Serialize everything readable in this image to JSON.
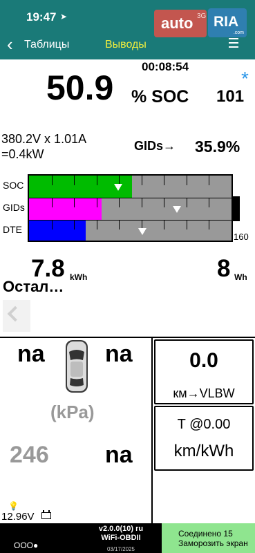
{
  "status_bar": {
    "time": "19:47",
    "arrow": "➤"
  },
  "watermark": {
    "left": "auto",
    "network": "3G",
    "right": "RIA",
    "domain": ".com"
  },
  "nav": {
    "back_label": "Таблицы",
    "outputs_label": "Выводы"
  },
  "main": {
    "timer": "00:08:54",
    "soc_value": "50.9",
    "soc_unit": "% SOC",
    "soc_count": "101",
    "star": "*",
    "voltage_line1": "380.2V x 1.01A",
    "voltage_line2": "=0.4kW",
    "gids_label": "GIDs→",
    "gids_percent": "35.9%",
    "bars": {
      "labels": [
        "SOC",
        "GIDs",
        "DTE"
      ],
      "fills": [
        0.51,
        0.36,
        0.28
      ],
      "markers": [
        0.44,
        0.73,
        0.56
      ],
      "colors": [
        "#00bb00",
        "#ff00ff",
        "#0000ff"
      ],
      "scale_max": "160"
    },
    "energy_value": "7.8",
    "energy_unit": "kWh",
    "wh_value": "8",
    "wh_unit": "Wh",
    "remaining_label": "Остал…"
  },
  "tires": {
    "front_left": "na",
    "front_right": "na",
    "rear_left": "246",
    "rear_right": "na",
    "unit": "(kPa)"
  },
  "aux_battery": {
    "voltage": "12.96V"
  },
  "box1": {
    "value": "0.0",
    "unit": "км→VLBW"
  },
  "box2": {
    "top": "T @0.00",
    "unit": "km/kWh"
  },
  "bottom": {
    "dots": "OOO●",
    "version": "v2.0.0(10) ru",
    "adapter": "WiFi-OBDII",
    "date": "03/17/2025",
    "connected": "Соединено 15",
    "freeze": "Заморозить экран"
  }
}
